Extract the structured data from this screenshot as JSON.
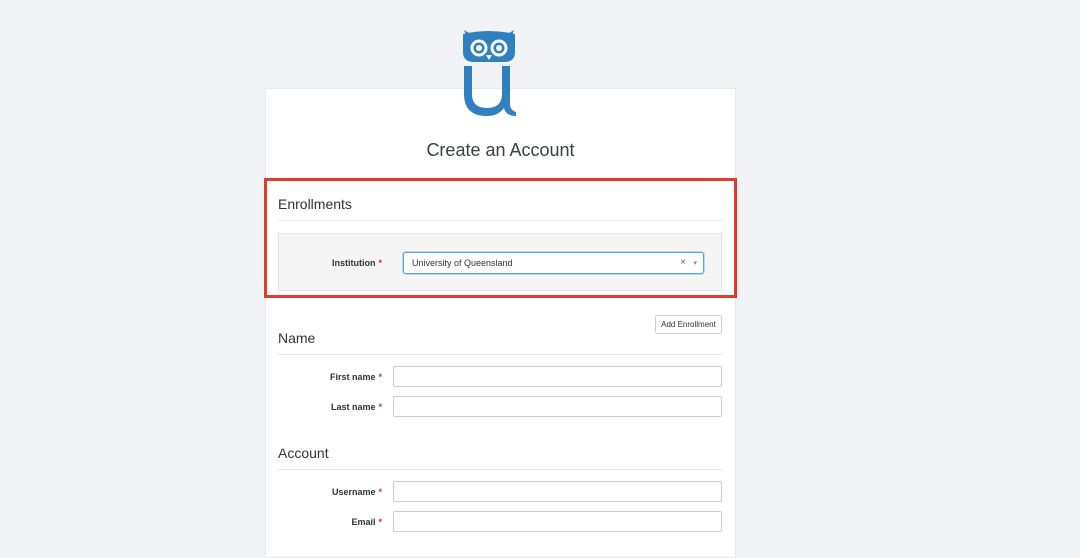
{
  "page": {
    "title": "Create an Account"
  },
  "colors": {
    "brand_blue": "#2f7fc1",
    "highlight_red": "#e03a2e",
    "required_red": "#d0312d",
    "focus_blue": "#5aa0e0"
  },
  "icons": {
    "logo": "owl-u-logo-icon",
    "clear": "clear-x-icon",
    "dropdown": "chevron-down-icon"
  },
  "enrollments": {
    "title": "Enrollments",
    "institution_label": "Institution",
    "institution_value": "University of Queensland",
    "clear_glyph": "×",
    "arrow_glyph": "▾",
    "add_button_label": "Add Enrollment"
  },
  "name_section": {
    "title": "Name",
    "first_name_label": "First name",
    "first_name_value": "",
    "last_name_label": "Last name",
    "last_name_value": ""
  },
  "account_section": {
    "title": "Account",
    "username_label": "Username",
    "username_value": "",
    "email_label": "Email",
    "email_value": ""
  },
  "required_marker": "*"
}
